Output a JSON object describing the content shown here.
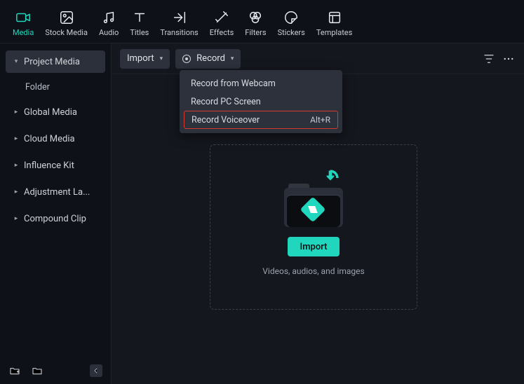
{
  "tabs": [
    {
      "label": "Media"
    },
    {
      "label": "Stock Media"
    },
    {
      "label": "Audio"
    },
    {
      "label": "Titles"
    },
    {
      "label": "Transitions"
    },
    {
      "label": "Effects"
    },
    {
      "label": "Filters"
    },
    {
      "label": "Stickers"
    },
    {
      "label": "Templates"
    }
  ],
  "sidebar": {
    "project_media": "Project Media",
    "folder": "Folder",
    "global_media": "Global Media",
    "cloud_media": "Cloud Media",
    "influence_kit": "Influence Kit",
    "adjustment": "Adjustment La...",
    "compound": "Compound Clip"
  },
  "toolbar": {
    "import": "Import",
    "record": "Record"
  },
  "record_menu": {
    "webcam": "Record from Webcam",
    "screen": "Record PC Screen",
    "voiceover": "Record Voiceover",
    "voiceover_shortcut": "Alt+R"
  },
  "drop": {
    "import_btn": "Import",
    "hint": "Videos, audios, and images"
  }
}
